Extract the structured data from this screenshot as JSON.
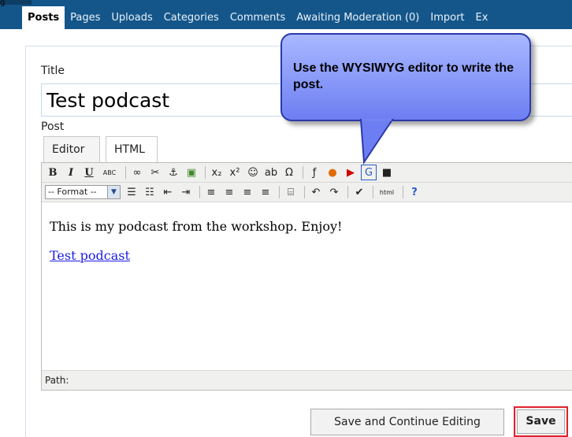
{
  "nav": {
    "tabs": [
      {
        "label": "Posts",
        "active": true
      },
      {
        "label": "Pages"
      },
      {
        "label": "Uploads"
      },
      {
        "label": "Categories"
      },
      {
        "label": "Comments"
      },
      {
        "label": "Awaiting Moderation (0)"
      },
      {
        "label": "Import"
      },
      {
        "label": "Ex"
      }
    ]
  },
  "form": {
    "title_label": "Title",
    "title_value": "Test podcast",
    "post_label": "Post",
    "editor_tabs": [
      "Editor",
      "HTML"
    ]
  },
  "editor": {
    "toolbar1": [
      {
        "glyph": "B",
        "icon": "bold-icon"
      },
      {
        "glyph": "I",
        "icon": "italic-icon"
      },
      {
        "glyph": "U",
        "icon": "underline-icon"
      },
      {
        "glyph": "ABC",
        "icon": "strikethrough-icon"
      },
      {
        "sep": true
      },
      {
        "glyph": "∞",
        "icon": "link-icon"
      },
      {
        "glyph": "✂",
        "icon": "unlink-icon"
      },
      {
        "glyph": "⚓",
        "icon": "anchor-icon"
      },
      {
        "glyph": "▣",
        "icon": "image-icon"
      },
      {
        "sep": true
      },
      {
        "glyph": "x₂",
        "icon": "subscript-icon"
      },
      {
        "glyph": "x²",
        "icon": "superscript-icon"
      },
      {
        "glyph": "☺",
        "icon": "emoticons-icon"
      },
      {
        "glyph": "ab",
        "icon": "spellcheck-icon"
      },
      {
        "glyph": "Ω",
        "icon": "special-char-icon"
      },
      {
        "sep": true
      },
      {
        "glyph": "ƒ",
        "icon": "flash-icon"
      },
      {
        "glyph": "●",
        "icon": "media-icon"
      },
      {
        "glyph": "▶",
        "icon": "youtube-icon"
      },
      {
        "glyph": "G",
        "icon": "google-icon"
      },
      {
        "glyph": "■",
        "icon": "block-icon"
      }
    ],
    "format_select": "-- Format --",
    "toolbar2": [
      {
        "glyph": "☰",
        "icon": "bullet-list-icon"
      },
      {
        "glyph": "☷",
        "icon": "numbered-list-icon"
      },
      {
        "glyph": "⇤",
        "icon": "outdent-icon"
      },
      {
        "glyph": "⇥",
        "icon": "indent-icon"
      },
      {
        "sep": true
      },
      {
        "glyph": "≡",
        "icon": "align-left-icon"
      },
      {
        "glyph": "≡",
        "icon": "align-center-icon"
      },
      {
        "glyph": "≡",
        "icon": "align-right-icon"
      },
      {
        "glyph": "≡",
        "icon": "align-justify-icon"
      },
      {
        "sep": true
      },
      {
        "glyph": "⌸",
        "icon": "page-break-icon"
      },
      {
        "sep": true
      },
      {
        "glyph": "↶",
        "icon": "undo-icon"
      },
      {
        "glyph": "↷",
        "icon": "redo-icon"
      },
      {
        "sep": true
      },
      {
        "glyph": "✔",
        "icon": "spell-check-dropdown-icon"
      },
      {
        "sep": true
      },
      {
        "glyph": "html",
        "icon": "html-source-icon"
      },
      {
        "sep": true
      },
      {
        "glyph": "?",
        "icon": "help-icon"
      }
    ],
    "content_text": "This is my podcast from the workshop. Enjoy!",
    "content_link": "Test podcast",
    "path_label": "Path:"
  },
  "buttons": {
    "save_continue": "Save and Continue Editing",
    "save": "Save"
  },
  "callout": {
    "text": "Use the WYSIWYG editor to write the post."
  },
  "colors": {
    "nav_bg": "#14568a",
    "highlight_border": "#e0212c",
    "callout_fill": "#8596f7"
  }
}
